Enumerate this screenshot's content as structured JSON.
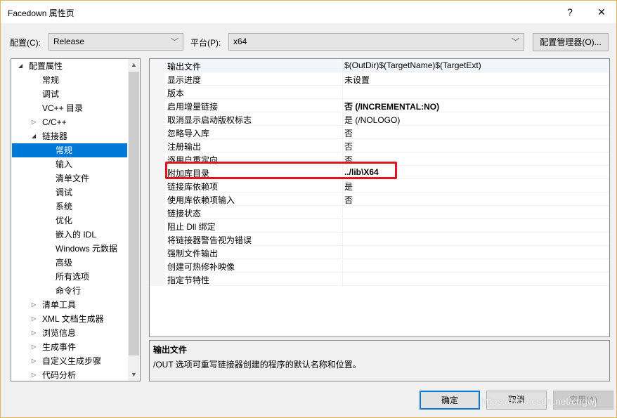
{
  "window": {
    "title": "Facedown 属性页",
    "help": "?",
    "close": "✕"
  },
  "config": {
    "label": "配置(C):",
    "value": "Release",
    "platform_label": "平台(P):",
    "platform_value": "x64",
    "manager_button": "配置管理器(O)..."
  },
  "tree": [
    {
      "label": "配置属性",
      "level": 0,
      "expander": "expanded"
    },
    {
      "label": "常规",
      "level": 1
    },
    {
      "label": "调试",
      "level": 1
    },
    {
      "label": "VC++ 目录",
      "level": 1
    },
    {
      "label": "C/C++",
      "level": 1,
      "expander": "collapsed"
    },
    {
      "label": "链接器",
      "level": 1,
      "expander": "expanded"
    },
    {
      "label": "常规",
      "level": 2,
      "selected": true
    },
    {
      "label": "输入",
      "level": 2
    },
    {
      "label": "清单文件",
      "level": 2
    },
    {
      "label": "调试",
      "level": 2
    },
    {
      "label": "系统",
      "level": 2
    },
    {
      "label": "优化",
      "level": 2
    },
    {
      "label": "嵌入的 IDL",
      "level": 2
    },
    {
      "label": "Windows 元数据",
      "level": 2
    },
    {
      "label": "高级",
      "level": 2
    },
    {
      "label": "所有选项",
      "level": 2
    },
    {
      "label": "命令行",
      "level": 2
    },
    {
      "label": "清单工具",
      "level": 1,
      "expander": "collapsed"
    },
    {
      "label": "XML 文档生成器",
      "level": 1,
      "expander": "collapsed"
    },
    {
      "label": "浏览信息",
      "level": 1,
      "expander": "collapsed"
    },
    {
      "label": "生成事件",
      "level": 1,
      "expander": "collapsed"
    },
    {
      "label": "自定义生成步骤",
      "level": 1,
      "expander": "collapsed"
    },
    {
      "label": "代码分析",
      "level": 1,
      "expander": "collapsed"
    }
  ],
  "properties": [
    {
      "name": "输出文件",
      "value": "$(OutDir)$(TargetName)$(TargetExt)"
    },
    {
      "name": "显示进度",
      "value": "未设置"
    },
    {
      "name": "版本",
      "value": ""
    },
    {
      "name": "启用增量链接",
      "value": "否 (/INCREMENTAL:NO)",
      "bold": true
    },
    {
      "name": "取消显示启动版权标志",
      "value": "是 (/NOLOGO)"
    },
    {
      "name": "忽略导入库",
      "value": "否"
    },
    {
      "name": "注册输出",
      "value": "否"
    },
    {
      "name": "逐用户重定向",
      "value": "否"
    },
    {
      "name": "附加库目录",
      "value": "../lib\\X64",
      "bold": true
    },
    {
      "name": "链接库依赖项",
      "value": "是"
    },
    {
      "name": "使用库依赖项输入",
      "value": "否"
    },
    {
      "name": "链接状态",
      "value": ""
    },
    {
      "name": "阻止 Dll 绑定",
      "value": ""
    },
    {
      "name": "将链接器警告视为错误",
      "value": ""
    },
    {
      "name": "强制文件输出",
      "value": ""
    },
    {
      "name": "创建可热修补映像",
      "value": ""
    },
    {
      "name": "指定节特性",
      "value": ""
    }
  ],
  "description": {
    "title": "输出文件",
    "text": "/OUT 选项可重写链接器创建的程序的默认名称和位置。"
  },
  "buttons": {
    "ok": "确定",
    "cancel": "取消",
    "apply": "应用(A)"
  },
  "watermark": "https://blog.csdn.net/cngwj",
  "colors": {
    "selection": "#0078d7",
    "highlight_box": "#e0141e",
    "ok_border": "#0078d7"
  }
}
